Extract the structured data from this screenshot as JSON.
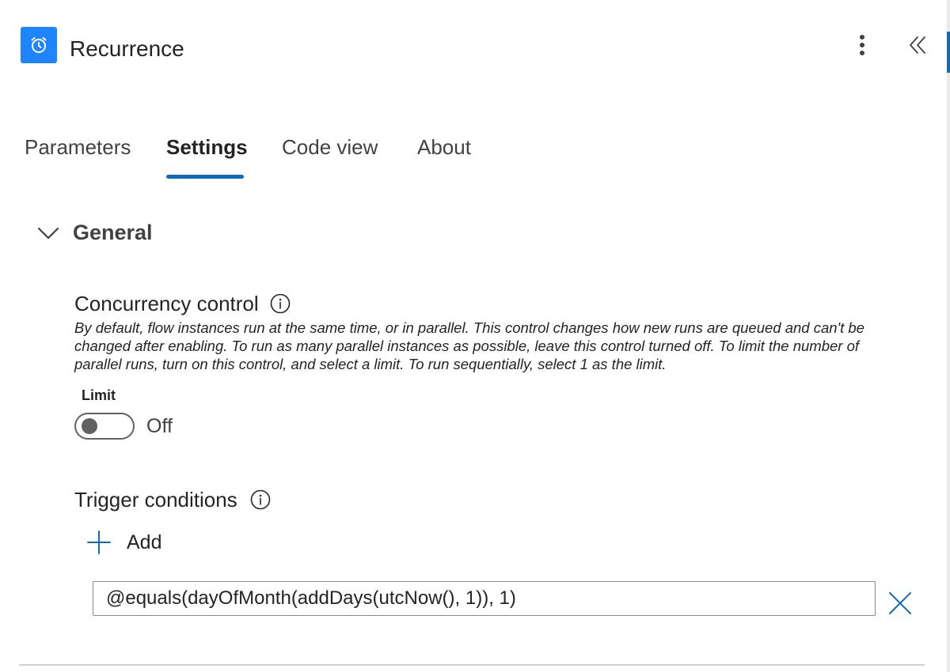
{
  "header": {
    "title": "Recurrence",
    "icon": "alarm-clock-icon",
    "icon_color": "#1f85ff"
  },
  "tabs": [
    {
      "label": "Parameters",
      "active": false
    },
    {
      "label": "Settings",
      "active": true
    },
    {
      "label": "Code view",
      "active": false
    },
    {
      "label": "About",
      "active": false
    }
  ],
  "accent_color": "#0f6cbd",
  "section": {
    "title": "General",
    "expanded": true
  },
  "concurrency": {
    "title": "Concurrency control",
    "description": "By default, flow instances run at the same time, or in parallel. This control changes how new runs are queued and can't be changed after enabling. To run as many parallel instances as possible, leave this control turned off. To limit the number of parallel runs, turn on this control, and select a limit. To run sequentially, select 1 as the limit.",
    "limit_label": "Limit",
    "toggle_state": "Off",
    "toggle_on": false
  },
  "trigger_conditions": {
    "title": "Trigger conditions",
    "add_label": "Add",
    "conditions": [
      {
        "value": "@equals(dayOfMonth(addDays(utcNow(), 1)), 1)"
      }
    ]
  }
}
